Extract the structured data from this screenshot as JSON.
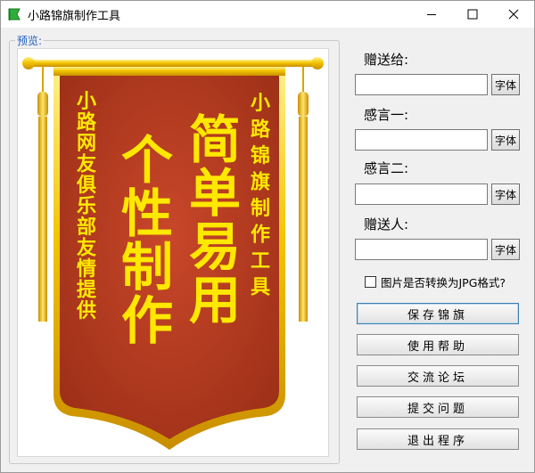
{
  "window": {
    "title": "小路锦旗制作工具"
  },
  "preview": {
    "group_label": "预览:",
    "banner": {
      "left_column": "小路网友俱乐部友情提供",
      "big_left": "个性制作",
      "big_right": "简单易用",
      "right_column": "小路锦旗制作工具"
    }
  },
  "form": {
    "recipient_label": "赠送给:",
    "thanks1_label": "感言一:",
    "thanks2_label": "感言二:",
    "giver_label": "赠送人:",
    "font_button": "字体",
    "recipient_value": "",
    "thanks1_value": "",
    "thanks2_value": "",
    "giver_value": "",
    "jpg_checkbox_label": "图片是否转换为JPG格式?",
    "jpg_checked": false
  },
  "buttons": {
    "save": "保存锦旗",
    "help": "使用帮助",
    "forum": "交流论坛",
    "issue": "提交问题",
    "exit": "退出程序"
  },
  "colors": {
    "banner_red": "#b33a1e",
    "banner_gold": "#f2c400",
    "text_yellow": "#ffe800"
  }
}
